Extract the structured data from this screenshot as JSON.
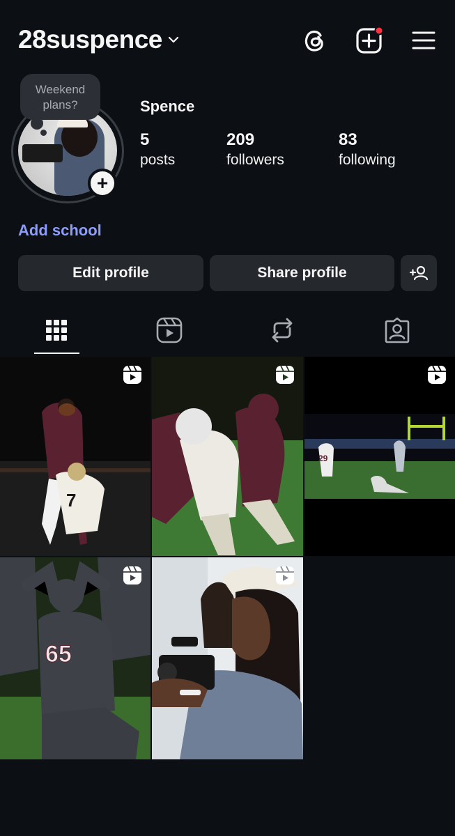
{
  "header": {
    "username": "28suspence",
    "icons": [
      "threads-icon",
      "create-post-icon",
      "menu-icon"
    ],
    "notification_dot_color": "#ff3040"
  },
  "profile": {
    "note": "Weekend plans?",
    "add_story_symbol": "+",
    "display_name": "Spence",
    "stats": [
      {
        "value": "5",
        "label": "posts"
      },
      {
        "value": "209",
        "label": "followers"
      },
      {
        "value": "83",
        "label": "following"
      }
    ],
    "add_school": "Add school"
  },
  "actions": {
    "edit_profile": "Edit profile",
    "share_profile": "Share profile",
    "suggest_icon": "add-person-icon"
  },
  "tabs": [
    {
      "name": "grid",
      "icon": "grid-icon",
      "active": true
    },
    {
      "name": "reels",
      "icon": "reels-icon",
      "active": false
    },
    {
      "name": "reposts",
      "icon": "repost-icon",
      "active": false
    },
    {
      "name": "tagged",
      "icon": "tagged-icon",
      "active": false
    }
  ],
  "posts": [
    {
      "type": "reel",
      "jersey": "7"
    },
    {
      "type": "reel",
      "jersey": ""
    },
    {
      "type": "reel",
      "jersey": "29"
    },
    {
      "type": "reel",
      "jersey": "65"
    },
    {
      "type": "reel",
      "jersey": ""
    }
  ],
  "colors": {
    "background": "#0c1014",
    "button": "#25292e",
    "link": "#8c9dff",
    "maroon": "#5a2230",
    "field_green": "#3f7a35"
  }
}
